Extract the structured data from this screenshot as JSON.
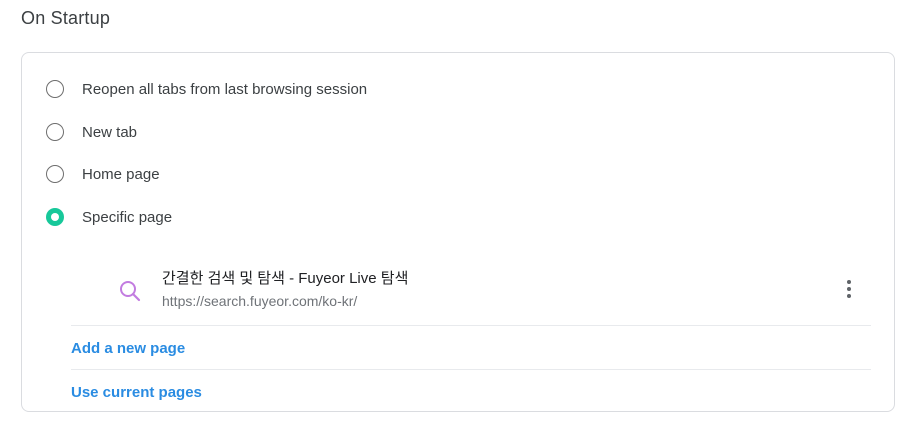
{
  "section": {
    "title": "On Startup"
  },
  "startup_options": [
    {
      "label": "Reopen all tabs from last browsing session",
      "checked": false
    },
    {
      "label": "New tab",
      "checked": false
    },
    {
      "label": "Home page",
      "checked": false
    },
    {
      "label": "Specific page",
      "checked": true
    }
  ],
  "pages": [
    {
      "title": "간결한 검색 및 탐색 - Fuyeor Live 탐색",
      "url": "https://search.fuyeor.com/ko-kr/",
      "icon": "search-icon"
    }
  ],
  "actions": {
    "add_page": "Add a new page",
    "use_current": "Use current pages"
  },
  "colors": {
    "accent_radio": "#17c89a",
    "link": "#2a8ce2",
    "search_icon": "#c27ce0"
  }
}
